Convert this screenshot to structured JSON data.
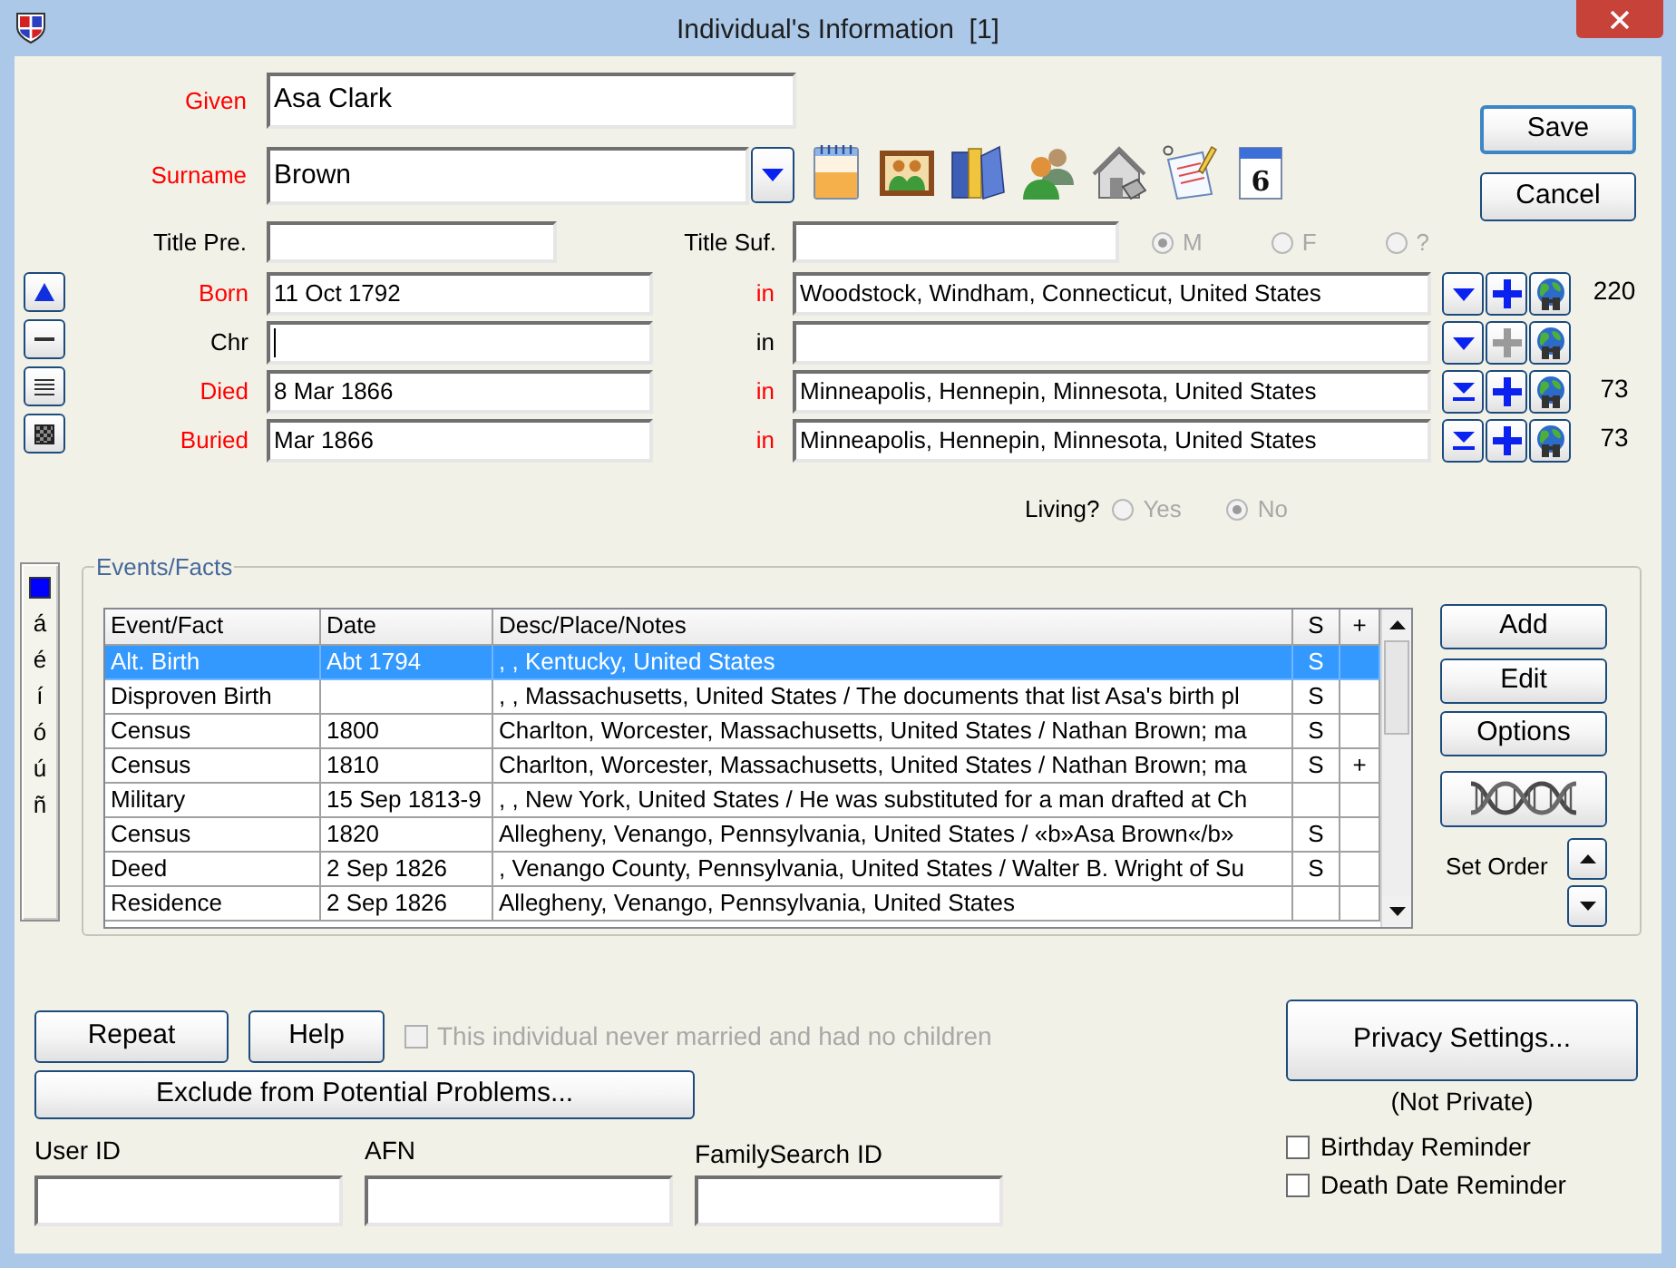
{
  "window": {
    "title": "Individual's Information  [1]"
  },
  "name_fields": [
    {
      "label": "Given",
      "highlighted": true,
      "value": "Asa Clark"
    },
    {
      "label": "Surname",
      "highlighted": true,
      "value": "Brown"
    }
  ],
  "toolbar_icons": [
    {
      "kind": "notes"
    },
    {
      "kind": "pictures"
    },
    {
      "kind": "sources"
    },
    {
      "kind": "associates"
    },
    {
      "kind": "address"
    },
    {
      "kind": "todo"
    },
    {
      "kind": "calendar",
      "day": "6"
    }
  ],
  "dialog_buttons": [
    {
      "label": "Save",
      "default": true
    },
    {
      "label": "Cancel",
      "default": false
    }
  ],
  "titles": [
    {
      "label": "Title Pre."
    },
    {
      "label": "Title Suf."
    }
  ],
  "sex": {
    "disabled": true,
    "options": [
      {
        "label": "M",
        "selected": true
      },
      {
        "label": "F",
        "selected": false
      },
      {
        "label": "?",
        "selected": false
      }
    ]
  },
  "side_buttons": [
    {
      "kind": "up"
    },
    {
      "kind": "single"
    },
    {
      "kind": "multi"
    },
    {
      "kind": "all"
    }
  ],
  "facts": [
    {
      "label": "Born",
      "highlighted": true,
      "focused": false,
      "date": "11 Oct 1792",
      "in_label": "in",
      "place": "Woodstock, Windham, Connecticut, United States",
      "extended_menu": false,
      "add_enabled": true,
      "number": "220"
    },
    {
      "label": "Chr",
      "highlighted": false,
      "focused": true,
      "in_label": "in",
      "extended_menu": false,
      "add_enabled": false
    },
    {
      "label": "Died",
      "highlighted": true,
      "focused": false,
      "date": "8 Mar 1866",
      "in_label": "in",
      "place": "Minneapolis, Hennepin, Minnesota, United States",
      "extended_menu": true,
      "add_enabled": true,
      "number": "73"
    },
    {
      "label": "Buried",
      "highlighted": true,
      "focused": false,
      "date": "Mar 1866",
      "in_label": "in",
      "place": "Minneapolis, Hennepin, Minnesota, United States",
      "extended_menu": true,
      "add_enabled": true,
      "number": "73"
    }
  ],
  "living": {
    "label": "Living?",
    "disabled": true,
    "options": [
      {
        "label": "Yes",
        "selected": false
      },
      {
        "label": "No",
        "selected": true
      }
    ]
  },
  "char_palette": {
    "chars": [
      "á",
      "é",
      "í",
      "ó",
      "ú",
      "ñ"
    ]
  },
  "events": {
    "title": "Events/Facts",
    "columns": [
      "Event/Fact",
      "Date",
      "Desc/Place/Notes",
      "S",
      "+"
    ],
    "rows": [
      {
        "event": "Alt. Birth",
        "date": "Abt 1794",
        "desc": ", , Kentucky, United States",
        "s": "S",
        "selected": true
      },
      {
        "event": "Disproven Birth",
        "desc": ", , Massachusetts, United States / The documents that list Asa's birth pl",
        "s": "S",
        "selected": false
      },
      {
        "event": "Census",
        "date": "1800",
        "desc": "Charlton, Worcester, Massachusetts, United States / Nathan Brown; ma",
        "s": "S",
        "selected": false
      },
      {
        "event": "Census",
        "date": "1810",
        "desc": "Charlton, Worcester, Massachusetts, United States / Nathan Brown; ma",
        "s": "S",
        "plus": "+",
        "selected": false
      },
      {
        "event": "Military",
        "date": "15 Sep 1813-9",
        "desc": ", , New York, United States / He was substituted for a man drafted at Ch",
        "selected": false
      },
      {
        "event": "Census",
        "date": "1820",
        "desc": "Allegheny, Venango, Pennsylvania, United States / «b»Asa Brown«/b»",
        "s": "S",
        "selected": false
      },
      {
        "event": "Deed",
        "date": "2 Sep 1826",
        "desc": ", Venango County, Pennsylvania, United States / Walter B. Wright of Su",
        "s": "S",
        "selected": false
      },
      {
        "event": "Residence",
        "date": "2 Sep 1826",
        "desc": "Allegheny, Venango, Pennsylvania, United States",
        "selected": false
      }
    ],
    "buttons": [
      "Add",
      "Edit",
      "Options"
    ],
    "set_order_label": "Set Order"
  },
  "bottom_buttons": [
    "Repeat",
    "Help"
  ],
  "never_married": {
    "label": "This individual never married and had no children",
    "checked": false,
    "disabled": true
  },
  "exclude_button": "Exclude from Potential Problems...",
  "id_fields": [
    {
      "label": "User ID"
    },
    {
      "label": "AFN"
    },
    {
      "label": "FamilySearch ID"
    }
  ],
  "privacy": {
    "button": "Privacy Settings...",
    "status": "(Not Private)"
  },
  "reminders": [
    {
      "label": "Birthday Reminder",
      "checked": false
    },
    {
      "label": "Death Date Reminder",
      "checked": false
    }
  ]
}
